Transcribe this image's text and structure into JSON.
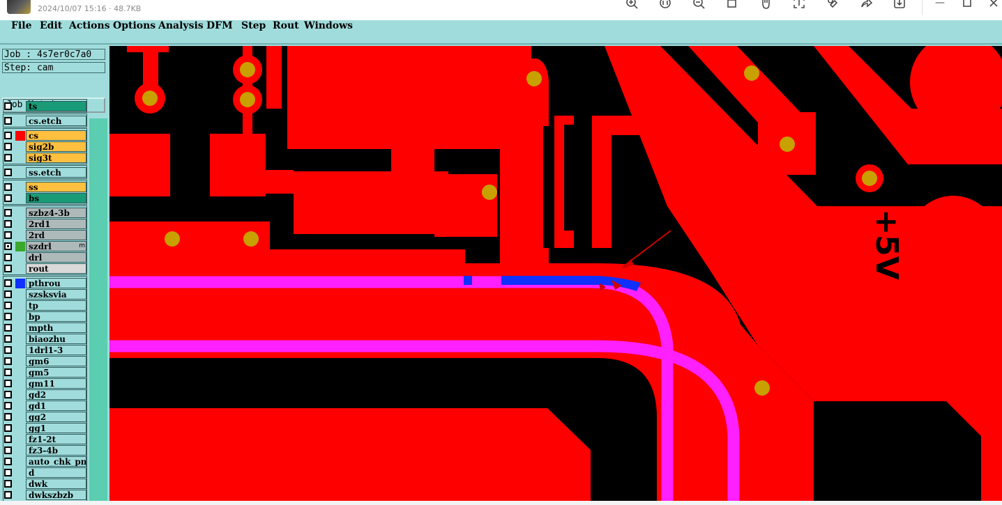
{
  "viewer": {
    "file_name": "",
    "meta": "2024/10/07 15:16 · 48.7KB",
    "tools": [
      "zoom-in-icon",
      "original-size-icon",
      "zoom-out-icon",
      "crop-icon",
      "hand-icon",
      "ocr-icon",
      "edit-icon",
      "share-icon",
      "download-icon"
    ]
  },
  "menu": [
    "File",
    "Edit",
    "Actions",
    "Options",
    "Analysis",
    "DFM",
    "Step",
    "Rout",
    "Windows"
  ],
  "panel": {
    "job": "Job : 4s7er0c7a0",
    "step": "Step: cam",
    "job_matrix": "Job Matrix ...",
    "layers": [
      {
        "name": "ts",
        "bg": "#1a9b78",
        "swatch": ""
      },
      {
        "name": "cs.etch",
        "bg": "#a1dcdc",
        "swatch": ""
      },
      {
        "name": "cs",
        "bg": "#ffc040",
        "swatch": "#ff0000"
      },
      {
        "name": "sig2b",
        "bg": "#ffc040",
        "swatch": ""
      },
      {
        "name": "sig3t",
        "bg": "#ffc040",
        "swatch": ""
      },
      {
        "name": "ss.etch",
        "bg": "#a1dcdc",
        "swatch": ""
      },
      {
        "name": "ss",
        "bg": "#ffc040",
        "swatch": ""
      },
      {
        "name": "bs",
        "bg": "#1a9b78",
        "swatch": ""
      },
      {
        "name": "szbz4-3b",
        "bg": "#aeb9ba",
        "swatch": ""
      },
      {
        "name": "2rd1",
        "bg": "#aeb9ba",
        "swatch": ""
      },
      {
        "name": "2rd",
        "bg": "#aeb9ba",
        "swatch": ""
      },
      {
        "name": "szdrl",
        "bg": "#aeb9ba",
        "swatch": "#3aa82a",
        "selected": true,
        "mark": "m"
      },
      {
        "name": "drl",
        "bg": "#aeb9ba",
        "swatch": ""
      },
      {
        "name": "rout",
        "bg": "#d9d9d9",
        "swatch": ""
      },
      {
        "name": "pthrou",
        "bg": "#a1dcdc",
        "swatch": "#1030ff"
      },
      {
        "name": "szsksvia",
        "bg": "#a1dcdc",
        "swatch": ""
      },
      {
        "name": "tp",
        "bg": "#a1dcdc",
        "swatch": ""
      },
      {
        "name": "bp",
        "bg": "#a1dcdc",
        "swatch": ""
      },
      {
        "name": "mpth",
        "bg": "#a1dcdc",
        "swatch": ""
      },
      {
        "name": "biaozhu",
        "bg": "#a1dcdc",
        "swatch": ""
      },
      {
        "name": "1drl1-3",
        "bg": "#a1dcdc",
        "swatch": ""
      },
      {
        "name": "gm6",
        "bg": "#a1dcdc",
        "swatch": ""
      },
      {
        "name": "gm5",
        "bg": "#a1dcdc",
        "swatch": ""
      },
      {
        "name": "gm11",
        "bg": "#a1dcdc",
        "swatch": ""
      },
      {
        "name": "gd2",
        "bg": "#a1dcdc",
        "swatch": ""
      },
      {
        "name": "gd1",
        "bg": "#a1dcdc",
        "swatch": ""
      },
      {
        "name": "gg2",
        "bg": "#a1dcdc",
        "swatch": ""
      },
      {
        "name": "gg1",
        "bg": "#a1dcdc",
        "swatch": ""
      },
      {
        "name": "fz1-2t",
        "bg": "#a1dcdc",
        "swatch": ""
      },
      {
        "name": "fz3-4b",
        "bg": "#a1dcdc",
        "swatch": ""
      },
      {
        "name": "auto_chk_pnl",
        "bg": "#a1dcdc",
        "swatch": ""
      },
      {
        "name": "d",
        "bg": "#a1dcdc",
        "swatch": ""
      },
      {
        "name": "dwk",
        "bg": "#a1dcdc",
        "swatch": ""
      },
      {
        "name": "dwkszbzb",
        "bg": "#a1dcdc",
        "swatch": ""
      }
    ]
  },
  "canvas": {
    "silk_text": "+5V",
    "colors": {
      "copper": "#ff0000",
      "pad": "#c8a000",
      "trace": "#ff20ff",
      "highlight": "#1030ff",
      "background": "#000000"
    }
  }
}
